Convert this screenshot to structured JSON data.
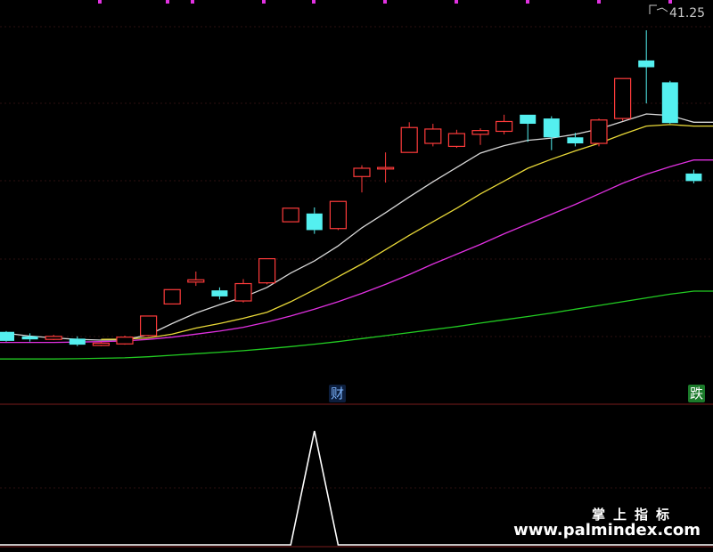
{
  "chart_data": [
    {
      "type": "candlestick",
      "y_range": [
        17.4,
        42.2
      ],
      "last_price_label": "41.25",
      "candles": [
        {
          "o": 20.9,
          "c": 20.3,
          "h": 20.95,
          "l": 20.25
        },
        {
          "o": 20.6,
          "c": 20.4,
          "h": 20.8,
          "l": 20.25
        },
        {
          "o": 20.4,
          "c": 20.6,
          "h": 20.7,
          "l": 20.35
        },
        {
          "o": 20.45,
          "c": 20.05,
          "h": 20.6,
          "l": 19.95
        },
        {
          "o": 20.0,
          "c": 20.15,
          "h": 20.25,
          "l": 19.95
        },
        {
          "o": 20.1,
          "c": 20.55,
          "h": 20.65,
          "l": 20.05
        },
        {
          "o": 20.65,
          "c": 21.95,
          "h": 21.95,
          "l": 20.6
        },
        {
          "o": 22.75,
          "c": 23.7,
          "h": 23.7,
          "l": 22.75
        },
        {
          "o": 24.2,
          "c": 24.35,
          "h": 24.9,
          "l": 23.95
        },
        {
          "o": 23.65,
          "c": 23.25,
          "h": 23.85,
          "l": 23.05
        },
        {
          "o": 22.95,
          "c": 24.1,
          "h": 24.4,
          "l": 22.85
        },
        {
          "o": 24.15,
          "c": 25.75,
          "h": 25.75,
          "l": 24.05
        },
        {
          "o": 28.2,
          "c": 29.1,
          "h": 29.1,
          "l": 28.2
        },
        {
          "o": 28.75,
          "c": 27.65,
          "h": 29.15,
          "l": 27.4
        },
        {
          "o": 27.75,
          "c": 29.55,
          "h": 29.55,
          "l": 27.65
        },
        {
          "o": 31.2,
          "c": 31.75,
          "h": 31.95,
          "l": 30.15
        },
        {
          "o": 31.7,
          "c": 31.8,
          "h": 32.8,
          "l": 30.8
        },
        {
          "o": 32.8,
          "c": 34.45,
          "h": 34.8,
          "l": 32.8
        },
        {
          "o": 33.4,
          "c": 34.35,
          "h": 34.7,
          "l": 33.2
        },
        {
          "o": 33.2,
          "c": 34.05,
          "h": 34.3,
          "l": 33.1
        },
        {
          "o": 34.0,
          "c": 34.25,
          "h": 34.4,
          "l": 33.3
        },
        {
          "o": 34.2,
          "c": 34.85,
          "h": 35.3,
          "l": 34.0
        },
        {
          "o": 35.3,
          "c": 34.7,
          "h": 35.3,
          "l": 33.5
        },
        {
          "o": 35.05,
          "c": 33.8,
          "h": 35.2,
          "l": 32.95
        },
        {
          "o": 33.8,
          "c": 33.4,
          "h": 34.1,
          "l": 33.2
        },
        {
          "o": 33.4,
          "c": 34.95,
          "h": 35.05,
          "l": 33.2
        },
        {
          "o": 35.05,
          "c": 37.7,
          "h": 37.7,
          "l": 34.9
        },
        {
          "o": 38.9,
          "c": 38.45,
          "h": 40.9,
          "l": 36.05
        },
        {
          "o": 37.45,
          "c": 34.75,
          "h": 37.55,
          "l": 34.7
        },
        {
          "o": 31.4,
          "c": 30.9,
          "h": 31.65,
          "l": 30.75
        }
      ],
      "ma_lines": [
        {
          "color": "#d8d8d8",
          "values": [
            20.8,
            20.62,
            20.5,
            20.4,
            20.35,
            20.38,
            20.7,
            21.45,
            22.15,
            22.7,
            23.2,
            23.85,
            24.8,
            25.6,
            26.6,
            27.8,
            28.8,
            29.85,
            30.85,
            31.8,
            32.75,
            33.25,
            33.6,
            33.75,
            34.0,
            34.35,
            34.85,
            35.35,
            35.25,
            34.8
          ]
        },
        {
          "color": "#e8d838",
          "values": [
            null,
            null,
            null,
            null,
            20.4,
            20.42,
            20.5,
            20.75,
            21.15,
            21.45,
            21.8,
            22.2,
            22.9,
            23.7,
            24.55,
            25.4,
            26.35,
            27.3,
            28.2,
            29.1,
            30.05,
            30.9,
            31.75,
            32.35,
            32.9,
            33.4,
            34.0,
            34.55,
            34.65,
            34.55
          ]
        },
        {
          "color": "#e030e0",
          "values": [
            20.2,
            20.2,
            20.2,
            20.22,
            20.25,
            20.3,
            20.4,
            20.55,
            20.75,
            20.95,
            21.2,
            21.55,
            21.95,
            22.4,
            22.9,
            23.45,
            24.05,
            24.7,
            25.4,
            26.05,
            26.7,
            27.4,
            28.05,
            28.7,
            29.35,
            30.05,
            30.75,
            31.35,
            31.85,
            32.3
          ]
        },
        {
          "color": "#22cc22",
          "values": [
            19.1,
            19.1,
            19.1,
            19.12,
            19.15,
            19.18,
            19.25,
            19.35,
            19.45,
            19.55,
            19.65,
            19.78,
            19.92,
            20.08,
            20.25,
            20.45,
            20.65,
            20.85,
            21.05,
            21.25,
            21.48,
            21.7,
            21.92,
            22.15,
            22.4,
            22.65,
            22.9,
            23.15,
            23.4,
            23.6
          ]
        }
      ],
      "event_markers": [
        {
          "candle_index": 13,
          "label": "财"
        },
        {
          "candle_index": 29,
          "label": "跌"
        }
      ]
    },
    {
      "type": "line",
      "series": [
        {
          "color": "#ffffff",
          "values": [
            0,
            0,
            0,
            0,
            0,
            0,
            0,
            0,
            0,
            0,
            0,
            0,
            0,
            1,
            0,
            0,
            0,
            0,
            0,
            0,
            0,
            0,
            0,
            0,
            0,
            0,
            0,
            0,
            0,
            0
          ]
        }
      ],
      "y_range": [
        0,
        1
      ]
    }
  ],
  "watermark": {
    "line1": "掌上指标",
    "line2": "www.palmindex.com"
  }
}
